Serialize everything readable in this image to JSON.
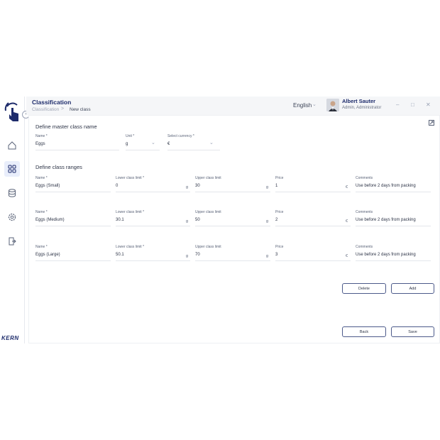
{
  "header": {
    "title": "Classification",
    "breadcrumb": [
      "Classification",
      "New class"
    ],
    "language": "English",
    "user_name": "Albert Sauter",
    "user_role": "Admin, Administrator"
  },
  "sidebar": {
    "brand": "KERN"
  },
  "master": {
    "section_title": "Define master class name",
    "name_label": "Name *",
    "name_value": "Eggs",
    "unit_label": "Unit *",
    "unit_value": "g",
    "currency_label": "Select currency *",
    "currency_value": "€"
  },
  "ranges": {
    "section_title": "Define class ranges",
    "labels": {
      "name": "Name *",
      "lower": "Lower class limit *",
      "upper": "Upper class limit",
      "price": "Price",
      "comments": "Comments"
    },
    "unit": "g",
    "currency": "€",
    "rows": [
      {
        "name": "Eggs (Small)",
        "lower": "0",
        "upper": "30",
        "price": "1",
        "comments": "Use before 2 days from packing"
      },
      {
        "name": "Eggs (Medium)",
        "lower": "30.1",
        "upper": "50",
        "price": "2",
        "comments": "Use before 2 days from packing"
      },
      {
        "name": "Eggs (Large)",
        "lower": "50.1",
        "upper": "70",
        "price": "3",
        "comments": "Use before 2 days from packing"
      }
    ]
  },
  "buttons": {
    "delete": "Delete",
    "add": "Add",
    "back": "Back",
    "save": "Save"
  },
  "colors": {
    "brand": "#1d2b6b",
    "button_border": "#4c5a8a",
    "active_nav": "#e9eefb"
  }
}
